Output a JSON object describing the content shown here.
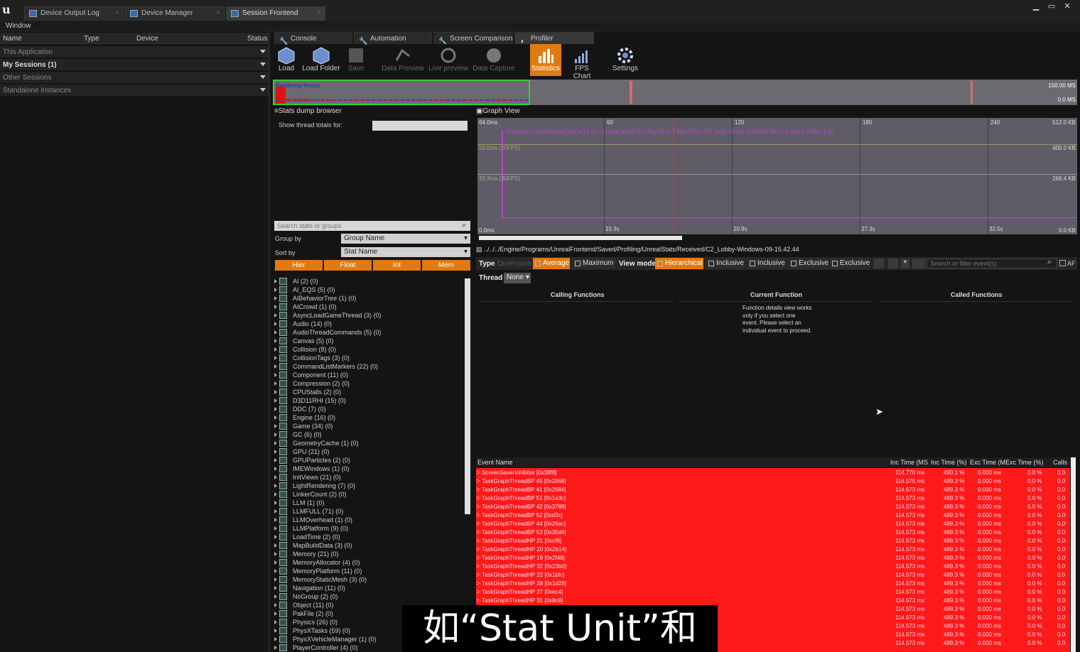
{
  "window": {
    "tabs": [
      "Device Output Log",
      "Device Manager",
      "Session Frontend"
    ],
    "menu": "Window",
    "controls": [
      "▁",
      "▭",
      "✕"
    ]
  },
  "sessions": {
    "headers": [
      "Name",
      "Type",
      "Device",
      "Status"
    ],
    "rows": [
      "This Application",
      "My Sessions (1)",
      "Other Sessions",
      "Standalone Instances"
    ]
  },
  "tool_tabs": [
    "Console",
    "Automation",
    "Screen Comparison",
    "Profiler"
  ],
  "toolbar": [
    {
      "label": "Load",
      "icon": "load-icon"
    },
    {
      "label": "Load Folder",
      "icon": "load-folder-icon"
    },
    {
      "label": "Save",
      "icon": "save-icon"
    },
    {
      "label": "Data Preview",
      "icon": "data-preview-icon"
    },
    {
      "label": "Live preview",
      "icon": "live-preview-icon"
    },
    {
      "label": "Data Capture",
      "icon": "data-capture-icon"
    },
    {
      "label": "Statistics",
      "icon": "statistics-icon"
    },
    {
      "label": "FPS Chart",
      "icon": "fps-chart-icon"
    },
    {
      "label": "Settings",
      "icon": "settings-icon"
    }
  ],
  "strip": {
    "thread1": "Rendering thread",
    "thread2": "Game thread",
    "max": "150.00 MS",
    "min": "0.0 MS"
  },
  "stats": {
    "title": "Stats dump browser",
    "show_totals": "Show thread totals for:",
    "search_placeholder": "Search stats or groups",
    "group_by": "Group by",
    "group_value": "Group Name",
    "sort_by": "Sort by",
    "sort_value": "Stat Name",
    "filters": [
      "Hier",
      "Float",
      "Int",
      "Mem"
    ],
    "groups": [
      "AI (2) (0)",
      "AI_EQS (5) (0)",
      "AIBehaviorTree (1) (0)",
      "AICrowd (1) (0)",
      "AsyncLoadGameThread (3) (0)",
      "Audio (14) (0)",
      "AudioThreadCommands (5) (0)",
      "Canvas (5) (0)",
      "Collision (8) (0)",
      "CollisionTags (3) (0)",
      "CommandListMarkers (22) (0)",
      "Component (11) (0)",
      "Compression (2) (0)",
      "CPUStalls (2) (0)",
      "D3D11RHI (15) (0)",
      "DDC (7) (0)",
      "Engine (16) (0)",
      "Game (34) (0)",
      "GC (6) (0)",
      "GeometryCache (1) (0)",
      "GPU (21) (0)",
      "GPUParticles (2) (0)",
      "IMEWindows (1) (0)",
      "InitViews (21) (0)",
      "LightRendering (7) (0)",
      "LinkerCount (2) (0)",
      "LLM (1) (0)",
      "LLMFULL (71) (0)",
      "LLMOverhead (1) (0)",
      "LLMPlatform (9) (0)",
      "LoadTime (2) (0)",
      "MapBuildData (3) (0)",
      "Memory (21) (0)",
      "MemoryAllocator (4) (0)",
      "MemoryPlatform (11) (0)",
      "MemoryStaticMesh (3) (0)",
      "Navigation (11) (0)",
      "NoGroup (2) (0)",
      "Object (11) (0)",
      "PakFile (2) (0)",
      "Physics (26) (0)",
      "PhysXTasks (59) (0)",
      "PhysXVehicleManager (1) (0)",
      "PlayerController (4) (0)"
    ]
  },
  "graph": {
    "title": "Graph View",
    "top_ms": "64.0ms",
    "x_ticks": [
      "60",
      "120",
      "180",
      "240"
    ],
    "legend": "[Threads] GameThread [0x7ec] 8.32 - (Value Min:8.251 Avg:23.417 Max:2004.237 (MS) / Calls (100.0%) Min:1.0 Avg:1.0 Max:1.0)",
    "y1": "50.0ms (20FPS)",
    "y2": "33.3ms (30FPS)",
    "y0": "0.0ms",
    "r1": "512.0 KB",
    "r2": "400.0 KB",
    "r3": "266.4 KB",
    "r0": "0.0 KB",
    "bottom_ticks": [
      "15.3s",
      "20.9s",
      "27.3s",
      "32.5s"
    ]
  },
  "path": "../../../Engine/Programs/UnrealFrontend/Saved/Profiling/UnrealStats/Received/C2_Lobby-Windows-09-15.42.44",
  "eventbar": {
    "type": "Type",
    "oneframe": "OneFrame",
    "average": "Average",
    "maximum": "Maximum",
    "viewmode": "View mode",
    "hierarchical": "Hierarchical",
    "inclusive1": "Inclusive",
    "inclusive2": "Inclusive",
    "exclusive1": "Exclusive",
    "exclusive2": "Exclusive",
    "search_placeholder": "Search or filter event(s)",
    "af": "AF",
    "thread": "Thread",
    "thread_value": "None"
  },
  "func": {
    "calling": "Calling Functions",
    "current": "Current Function",
    "called": "Called Functions",
    "details": "Function details view works only if you select one event. Please select an individual event to proceed."
  },
  "events": {
    "headers": [
      "Event Name",
      "Inc Time (MS",
      "Inc Time (%)",
      "Exc Time (M:",
      "Exc Time (%)",
      "Calls"
    ],
    "rows": [
      [
        "ScreenSaverInhibitor [0x38f8]",
        "114.770 ms",
        "490.1 %",
        "0.000 ms",
        "0.0 %",
        "0.0"
      ],
      [
        "TaskGraphThreadBP 45 [0x2868]",
        "114.575 ms",
        "489.3 %",
        "0.000 ms",
        "0.0 %",
        "0.0"
      ],
      [
        "TaskGraphThreadBP 41 [0x2684]",
        "114.573 ms",
        "489.3 %",
        "0.000 ms",
        "0.0 %",
        "0.0"
      ],
      [
        "TaskGraphThreadBP 51 [0x1a3c]",
        "114.573 ms",
        "489.3 %",
        "0.000 ms",
        "0.0 %",
        "0.0"
      ],
      [
        "TaskGraphThreadBP 42 [0x3798]",
        "114.573 ms",
        "489.3 %",
        "0.000 ms",
        "0.0 %",
        "0.0"
      ],
      [
        "TaskGraphThreadBP 52 [0xd3c]",
        "114.573 ms",
        "489.3 %",
        "0.000 ms",
        "0.0 %",
        "0.0"
      ],
      [
        "TaskGraphThreadBP 44 [0x26ac]",
        "114.573 ms",
        "489.3 %",
        "0.000 ms",
        "0.0 %",
        "0.0"
      ],
      [
        "TaskGraphThreadBP 53 [0x35d4]",
        "114.573 ms",
        "489.3 %",
        "0.000 ms",
        "0.0 %",
        "0.0"
      ],
      [
        "TaskGraphThreadHP 21 [0xcf8]",
        "114.573 ms",
        "489.3 %",
        "0.000 ms",
        "0.0 %",
        "0.0"
      ],
      [
        "TaskGraphThreadHP 20 [0x2b14]",
        "114.573 ms",
        "489.3 %",
        "0.000 ms",
        "0.0 %",
        "0.0"
      ],
      [
        "TaskGraphThreadHP 19 [0x2f48]",
        "114.573 ms",
        "489.3 %",
        "0.000 ms",
        "0.0 %",
        "0.0"
      ],
      [
        "TaskGraphThreadHP 32 [0x23b0]",
        "114.573 ms",
        "489.3 %",
        "0.000 ms",
        "0.0 %",
        "0.0"
      ],
      [
        "TaskGraphThreadHP 22 [0x1bfc]",
        "114.573 ms",
        "489.3 %",
        "0.000 ms",
        "0.0 %",
        "0.0"
      ],
      [
        "TaskGraphThreadHP 28 [0x1d28]",
        "114.573 ms",
        "489.3 %",
        "0.000 ms",
        "0.0 %",
        "0.0"
      ],
      [
        "TaskGraphThreadHP 27 [0xec4]",
        "114.573 ms",
        "489.3 %",
        "0.000 ms",
        "0.0 %",
        "0.0"
      ],
      [
        "TaskGraphThreadHP 31 [0x8c8]",
        "114.573 ms",
        "489.3 %",
        "0.000 ms",
        "0.0 %",
        "0.0"
      ],
      [
        "TaskGraphThreadHP 33 [0x2424]",
        "114.573 ms",
        "489.3 %",
        "0.000 ms",
        "0.0 %",
        "0.0"
      ],
      [
        "TaskGraphThreadHP 30 [0x12f8]",
        "114.573 ms",
        "489.3 %",
        "0.000 ms",
        "0.0 %",
        "0.0"
      ],
      [
        "TaskGraphThreadHP 29 [0x2c0c]",
        "114.573 ms",
        "489.3 %",
        "0.000 ms",
        "0.0 %",
        "0.0"
      ],
      [
        "TaskGraphThreadHP 24 [0x3dcc]",
        "114.573 ms",
        "489.3 %",
        "0.000 ms",
        "0.0 %",
        "0.0"
      ],
      [
        "TaskGraphThreadHP 25 [0x1b70]",
        "114.573 ms",
        "489.3 %",
        "0.000 ms",
        "0.0 %",
        "0.0"
      ],
      [
        "TaskGraphThreadHP 26 [0x3e2c]",
        "114.573 ms",
        "489.3 %",
        "0.000 ms",
        "0.0 %",
        "0.0"
      ]
    ]
  },
  "subtitle": "如“Stat Unit”和",
  "colors": {
    "accent": "#e07a10",
    "event_rows": "#ff1a1a"
  }
}
